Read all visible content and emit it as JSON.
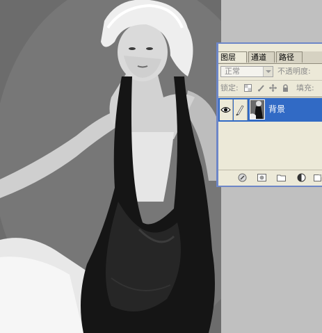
{
  "layers_panel": {
    "tabs": [
      {
        "label": "图层"
      },
      {
        "label": "通道"
      },
      {
        "label": "路径"
      }
    ],
    "blend_mode": "正常",
    "opacity_label": "不透明度:",
    "lock_label": "锁定:",
    "fill_label": "填充:",
    "layers": [
      {
        "name": "背景",
        "visible": true,
        "selected": true
      }
    ],
    "lock_icons": [
      "lock-transparency-icon",
      "lock-image-icon",
      "lock-position-icon",
      "lock-all-icon"
    ],
    "bottom_icons": [
      "link-layers-icon",
      "add-mask-icon",
      "new-group-icon",
      "adjustment-layer-icon",
      "new-layer-icon"
    ],
    "colors": {
      "selection": "#316ac5",
      "frame": "#6d86c7",
      "panel": "#ece9d8"
    }
  }
}
